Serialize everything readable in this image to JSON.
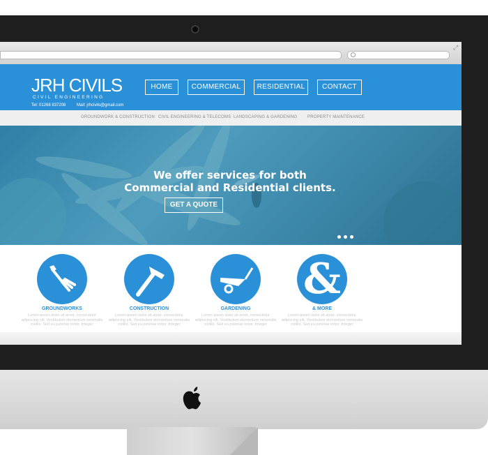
{
  "browser": {
    "search_placeholder": ""
  },
  "site": {
    "logo": "JRH CIVILS",
    "logo_sub": "CIVIL ENGINEERING",
    "tel": "Tel: 01268 837208",
    "mail": "Mail: jrhcivils@gmail.com"
  },
  "nav": [
    {
      "label": "HOME"
    },
    {
      "label": "COMMERCIAL"
    },
    {
      "label": "RESIDENTIAL"
    },
    {
      "label": "CONTACT"
    }
  ],
  "subnav": [
    {
      "label": "GROUNDWORK & CONSTRUCTION"
    },
    {
      "label": "CIVIL ENGINEERING & TELECOMS"
    },
    {
      "label": "LANDSCAPING & GARDENING"
    },
    {
      "label": "PROPERTY MAINTENANCE"
    }
  ],
  "hero": {
    "line1": "We offer services for both",
    "line2": "Commercial and Residential clients.",
    "cta": "GET A QUOTE",
    "slides": 3
  },
  "services": [
    {
      "title": "GROUNDWORKS",
      "icon": "fork-icon",
      "text": "Lorem ipsum dolor sit amet, consectetur adipiscing elit. Vestibulum elementum venenatis mollis. Sed eu pulvinar tortor. Integer"
    },
    {
      "title": "CONSTRUCTION",
      "icon": "hammer-icon",
      "text": "Lorem ipsum dolor sit amet, consectetur adipiscing elit. Vestibulum elementum venenatis mollis. Sed eu pulvinar tortor. Integer"
    },
    {
      "title": "GARDENING",
      "icon": "wheelbarrow-icon",
      "text": "Lorem ipsum dolor sit amet, consectetur adipiscing elit. Vestibulum elementum venenatis mollis. Sed eu pulvinar tortor. Integer"
    },
    {
      "title": "& MORE",
      "icon": "ampersand-icon",
      "text": "Lorem ipsum dolor sit amet, consectetur adipiscing elit. Vestibulum elementum venenatis mollis. Sed eu pulvinar tortor. Integer"
    }
  ],
  "colors": {
    "brand_blue": "#2a91d8",
    "hero_tint": "#3b86a8",
    "bezel": "#1e1e1e"
  }
}
